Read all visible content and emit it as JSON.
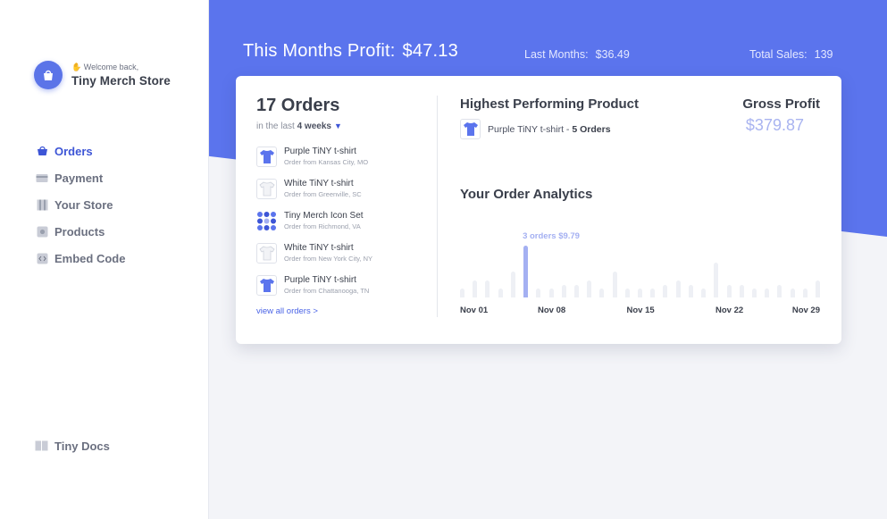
{
  "sidebar": {
    "welcome": "Welcome back,",
    "store_name": "Tiny Merch Store",
    "items": [
      {
        "label": "Orders",
        "icon": "basket-icon",
        "active": true
      },
      {
        "label": "Payment",
        "icon": "card-icon",
        "active": false
      },
      {
        "label": "Your Store",
        "icon": "store-icon",
        "active": false
      },
      {
        "label": "Products",
        "icon": "products-icon",
        "active": false
      },
      {
        "label": "Embed Code",
        "icon": "code-icon",
        "active": false
      }
    ],
    "docs_label": "Tiny Docs"
  },
  "hero": {
    "title": "This Months Profit:",
    "amount": "$47.13",
    "last_month_label": "Last Months:",
    "last_month_value": "$36.49",
    "total_sales_label": "Total Sales:",
    "total_sales_value": "139"
  },
  "orders": {
    "title": "17 Orders",
    "sub_prefix": "in the last",
    "sub_period": "4 weeks",
    "view_all": "view all orders >",
    "items": [
      {
        "name": "Purple TiNY t-shirt",
        "from": "Order from Kansas City, MO",
        "thumb": "purple-shirt"
      },
      {
        "name": "White TiNY t-shirt",
        "from": "Order from Greenville, SC",
        "thumb": "white-shirt"
      },
      {
        "name": "Tiny Merch Icon Set",
        "from": "Order from Richmond, VA",
        "thumb": "icon-set"
      },
      {
        "name": "White TiNY t-shirt",
        "from": "Order from New York City, NY",
        "thumb": "white-shirt"
      },
      {
        "name": "Purple TiNY t-shirt",
        "from": "Order from Chattanooga, TN",
        "thumb": "purple-shirt"
      }
    ]
  },
  "highest": {
    "title": "Highest Performing Product",
    "product": "Purple TiNY t-shirt -",
    "count": "5 Orders"
  },
  "gross": {
    "title": "Gross Profit",
    "value": "$379.87"
  },
  "analytics": {
    "title": "Your Order Analytics"
  },
  "colors": {
    "accent": "#5b74ed",
    "highlight_bar": "#a4b0f2",
    "bar": "#eef0f5"
  },
  "chart_data": {
    "type": "bar",
    "categories": [
      "Nov 01",
      "Nov 02",
      "Nov 03",
      "Nov 04",
      "Nov 05",
      "Nov 06",
      "Nov 07",
      "Nov 08",
      "Nov 09",
      "Nov 10",
      "Nov 11",
      "Nov 12",
      "Nov 13",
      "Nov 14",
      "Nov 15",
      "Nov 16",
      "Nov 17",
      "Nov 18",
      "Nov 19",
      "Nov 20",
      "Nov 21",
      "Nov 22",
      "Nov 23",
      "Nov 24",
      "Nov 25",
      "Nov 26",
      "Nov 27",
      "Nov 28",
      "Nov 29"
    ],
    "values": [
      0.5,
      1,
      1,
      0.5,
      1.5,
      3,
      0.5,
      0.5,
      0.75,
      0.75,
      1,
      0.5,
      1.5,
      0.5,
      0.5,
      0.5,
      0.75,
      1,
      0.75,
      0.5,
      2,
      0.75,
      0.75,
      0.5,
      0.5,
      0.75,
      0.5,
      0.5,
      1
    ],
    "ylim": [
      0,
      3
    ],
    "x_tick_labels": [
      "Nov 01",
      "Nov 08",
      "Nov 15",
      "Nov 22",
      "Nov 29"
    ],
    "highlight": {
      "index": 5,
      "label": "3 orders  $9.79"
    },
    "grid": false
  }
}
